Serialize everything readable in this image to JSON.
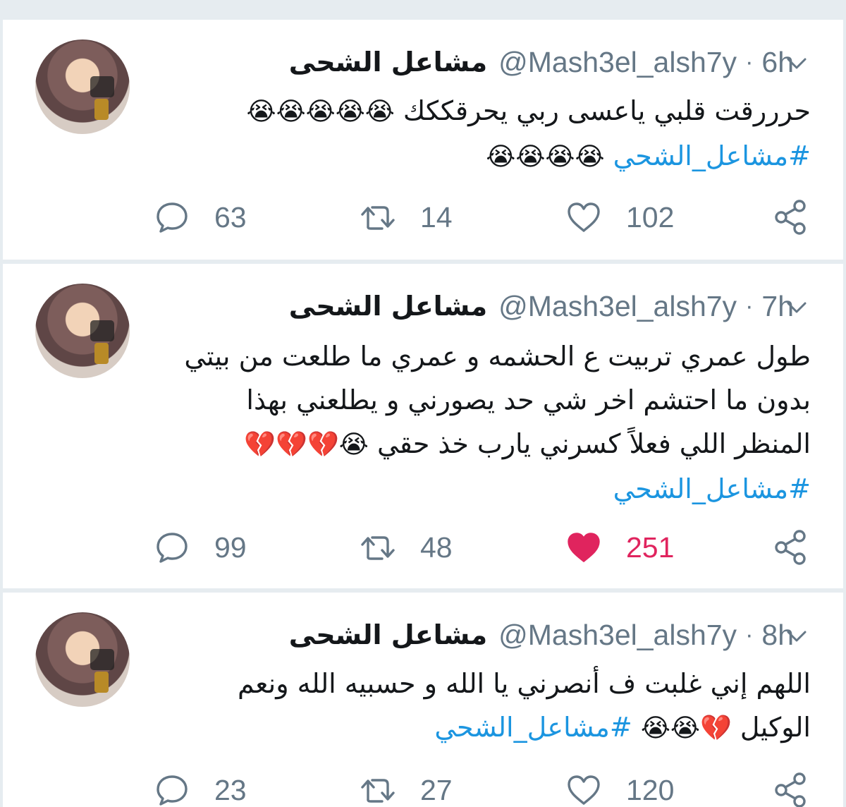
{
  "tweets": [
    {
      "display_name": "مشاعل الشحى",
      "handle": "@Mash3el_alsh7y",
      "separator": "·",
      "time": "6h",
      "lines": [
        {
          "text": "حرررقت قلبي ياعسى ربي يحرقككك",
          "emoji": "😭😭😭😭😭"
        },
        {
          "text": "",
          "emoji": "😭😭😭😭",
          "hashtag": "#مشاعل_الشحي"
        }
      ],
      "replies": "63",
      "retweets": "14",
      "likes": "102",
      "liked": false
    },
    {
      "display_name": "مشاعل الشحى",
      "handle": "@Mash3el_alsh7y",
      "separator": "·",
      "time": "7h",
      "lines": [
        {
          "text": "طول عمري تربيت ع الحشمه و عمري ما طلعت من بيتي"
        },
        {
          "text": "بدون ما احتشم اخر شي حد يصورني و يطلعني بهذا"
        },
        {
          "text": "المنظر اللي فعلاً كسرني يارب خذ حقي",
          "emoji": "😭💔💔💔"
        },
        {
          "text": "",
          "hashtag": "#مشاعل_الشحي"
        }
      ],
      "replies": "99",
      "retweets": "48",
      "likes": "251",
      "liked": true
    },
    {
      "display_name": "مشاعل الشحى",
      "handle": "@Mash3el_alsh7y",
      "separator": "·",
      "time": "8h",
      "lines": [
        {
          "text": "اللهم إني غلبت ف أنصرني يا الله و حسبيه الله ونعم"
        },
        {
          "text": "الوكيل",
          "emoji": "💔😭😭",
          "hashtag": "#مشاعل_الشحي"
        }
      ],
      "replies": "23",
      "retweets": "27",
      "likes": "120",
      "liked": false
    }
  ],
  "icons": {
    "reply": "speech-bubble-icon",
    "retweet": "retweet-icon",
    "like": "heart-icon",
    "share": "share-icon",
    "menu": "chevron-down-icon"
  },
  "colors": {
    "accent": "#1b95e0",
    "like": "#e0245e",
    "secondary_text": "#657786",
    "primary_text": "#14171a",
    "background": "#e6ecf0"
  }
}
